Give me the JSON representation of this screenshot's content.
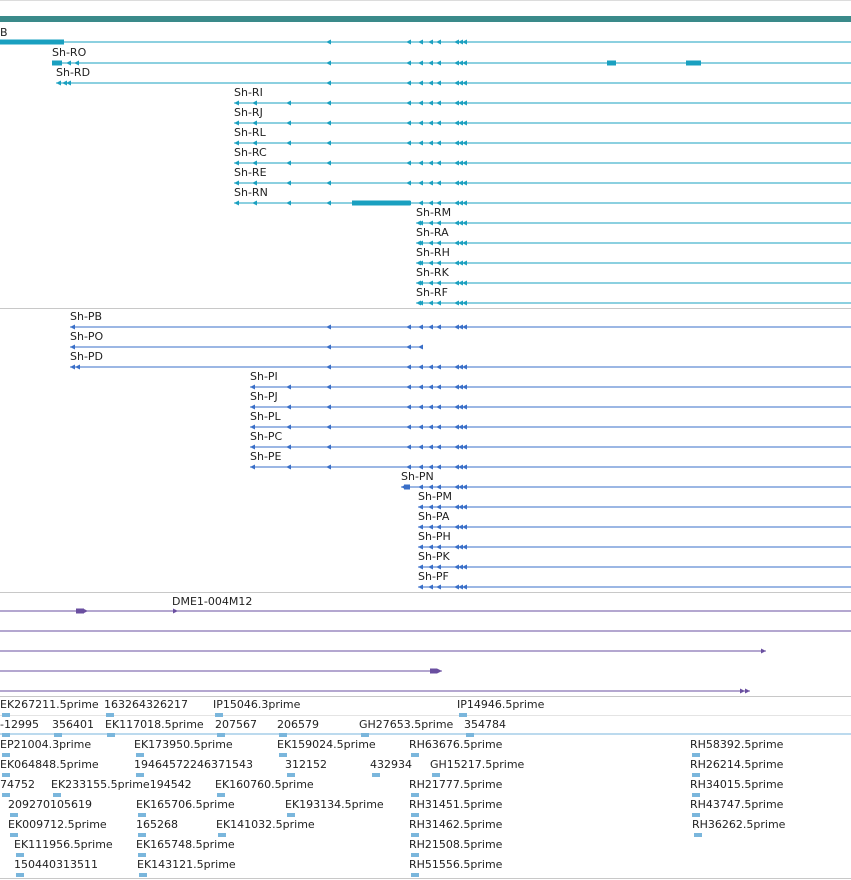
{
  "colors": {
    "track_bar": "#3a8a8a",
    "rna": "#1aa0c0",
    "protein": "#3a6fc8",
    "clone": "#6a4fa0",
    "est": "#7ab6dc",
    "divider": "#c8c8c8"
  },
  "rna_track": {
    "partial_label": "B",
    "transcripts": [
      {
        "label": "Sh-RO"
      },
      {
        "label": "Sh-RD"
      },
      {
        "label": "Sh-RI"
      },
      {
        "label": "Sh-RJ"
      },
      {
        "label": "Sh-RL"
      },
      {
        "label": "Sh-RC"
      },
      {
        "label": "Sh-RE"
      },
      {
        "label": "Sh-RN"
      },
      {
        "label": "Sh-RM"
      },
      {
        "label": "Sh-RA"
      },
      {
        "label": "Sh-RH"
      },
      {
        "label": "Sh-RK"
      },
      {
        "label": "Sh-RF"
      }
    ]
  },
  "protein_track": {
    "proteins": [
      {
        "label": "Sh-PB"
      },
      {
        "label": "Sh-PO"
      },
      {
        "label": "Sh-PD"
      },
      {
        "label": "Sh-PI"
      },
      {
        "label": "Sh-PJ"
      },
      {
        "label": "Sh-PL"
      },
      {
        "label": "Sh-PC"
      },
      {
        "label": "Sh-PE"
      },
      {
        "label": "Sh-PN"
      },
      {
        "label": "Sh-PM"
      },
      {
        "label": "Sh-PA"
      },
      {
        "label": "Sh-PH"
      },
      {
        "label": "Sh-PK"
      },
      {
        "label": "Sh-PF"
      }
    ]
  },
  "clone_track": {
    "label": "DME1-004M12"
  },
  "est_track": {
    "labels": [
      "EK267211.5prime",
      "163264326217",
      "IP15046.3prime",
      "IP14946.5prime",
      "-12995",
      "356401",
      "EK117018.5prime",
      "207567",
      "206579",
      "GH27653.5prime",
      "354784",
      "EP21004.3prime",
      "EK173950.5prime",
      "EK159024.5prime",
      "RH63676.5prime",
      "RH58392.5prime",
      "EK064848.5prime",
      "19464572246371543",
      "312152",
      "432934",
      "GH15217.5prime",
      "RH26214.5prime",
      "74752",
      "EK233155.5prime194542",
      "EK160760.5prime",
      "RH21777.5prime",
      "RH34015.5prime",
      "209270105619",
      "EK165706.5prime",
      "EK193134.5prime",
      "RH31451.5prime",
      "RH43747.5prime",
      "EK009712.5prime",
      "165268",
      "EK141032.5prime",
      "RH31462.5prime",
      "RH36262.5prime",
      "EK111956.5prime",
      "EK165748.5prime",
      "RH21508.5prime",
      "150440313511",
      "EK143121.5prime",
      "RH51556.5prime"
    ]
  }
}
